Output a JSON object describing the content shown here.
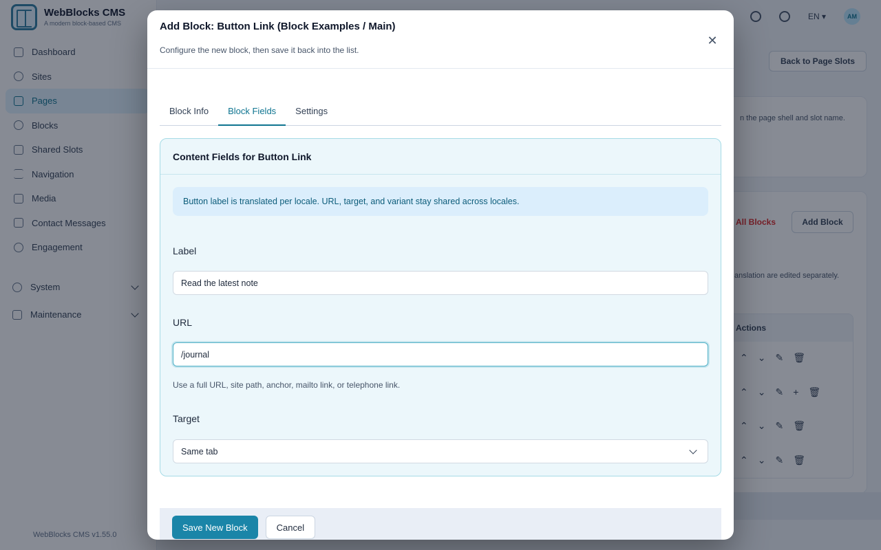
{
  "app": {
    "brand_name": "WebBlocks CMS",
    "brand_tagline": "A modern block-based CMS",
    "version": "WebBlocks CMS v1.55.0",
    "locale": "EN",
    "avatar_initials": "AM",
    "back_button": "Back to Page Slots",
    "card_text": "n the page shell and slot name.",
    "delete_all": "All Blocks",
    "add_block": "Add Block",
    "translation_note": "anslation are edited separately.",
    "table_header": "Actions"
  },
  "sidebar": {
    "items": [
      {
        "label": "Dashboard",
        "icon": "dashboard-icon"
      },
      {
        "label": "Sites",
        "icon": "globe-icon"
      },
      {
        "label": "Pages",
        "icon": "page-icon"
      },
      {
        "label": "Blocks",
        "icon": "blocks-icon"
      },
      {
        "label": "Shared Slots",
        "icon": "layers-icon"
      },
      {
        "label": "Navigation",
        "icon": "menu-icon"
      },
      {
        "label": "Media",
        "icon": "image-icon"
      },
      {
        "label": "Contact Messages",
        "icon": "mail-icon"
      },
      {
        "label": "Engagement",
        "icon": "star-icon"
      }
    ],
    "groups": [
      {
        "label": "System",
        "icon": "gear-icon"
      },
      {
        "label": "Maintenance",
        "icon": "file-icon"
      }
    ]
  },
  "modal": {
    "title": "Add Block: Button Link (Block Examples / Main)",
    "subtitle": "Configure the new block, then save it back into the list.",
    "tabs": [
      {
        "label": "Block Info",
        "active": false
      },
      {
        "label": "Block Fields",
        "active": true
      },
      {
        "label": "Settings",
        "active": false
      }
    ],
    "fields_card": {
      "title": "Content Fields for Button Link",
      "info": "Button label is translated per locale. URL, target, and variant stay shared across locales.",
      "label_field": {
        "label": "Label",
        "value": "Read the latest note"
      },
      "url_field": {
        "label": "URL",
        "value": "/journal",
        "help": "Use a full URL, site path, anchor, mailto link, or telephone link."
      },
      "target_field": {
        "label": "Target",
        "value": "Same tab"
      }
    },
    "footer": {
      "save_label": "Save New Block",
      "cancel_label": "Cancel"
    }
  },
  "colors": {
    "accent": "#1a85a8",
    "card_bg": "#ecf7fb",
    "card_border": "#a5dbe6",
    "info_bg": "#dbeefc"
  }
}
